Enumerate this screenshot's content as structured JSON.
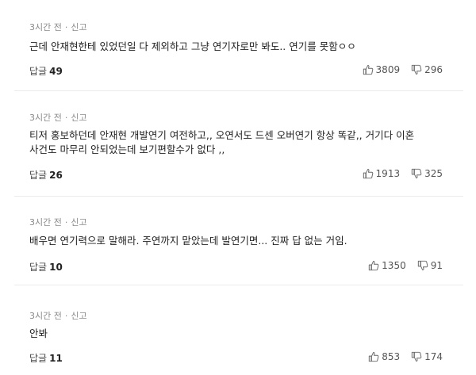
{
  "comments": [
    {
      "time": "3시간 전",
      "separator": "·",
      "report": "신고",
      "text": "근데 안재현한테 있었던일 다 제외하고 그냥 연기자로만 봐도.. 연기를 못함ㅇㅇ",
      "reply_label": "답글",
      "reply_count": "49",
      "likes": "3809",
      "dislikes": "296"
    },
    {
      "time": "3시간 전",
      "separator": "·",
      "report": "신고",
      "text": "티저 홍보하던데 안재현 개발연기 여전하고,, 오연서도 드센 오버연기 항상 똑같,, 거기다 이혼\n사건도 마무리 안되었는데 보기편할수가 없다 ,,",
      "reply_label": "답글",
      "reply_count": "26",
      "likes": "1913",
      "dislikes": "325"
    },
    {
      "time": "3시간 전",
      "separator": "·",
      "report": "신고",
      "text": "배우면 연기력으로 말해라. 주연까지 맡았는데 발연기면... 진짜 답 없는 거임.",
      "reply_label": "답글",
      "reply_count": "10",
      "likes": "1350",
      "dislikes": "91"
    },
    {
      "time": "3시간 전",
      "separator": "·",
      "report": "신고",
      "text": "안봐",
      "reply_label": "답글",
      "reply_count": "11",
      "likes": "853",
      "dislikes": "174"
    }
  ],
  "icons": {
    "like": "thumbs-up-icon",
    "dislike": "thumbs-down-icon"
  },
  "colors": {
    "meta": "#8a8a8a",
    "text": "#222222",
    "divider": "#ebebeb"
  }
}
